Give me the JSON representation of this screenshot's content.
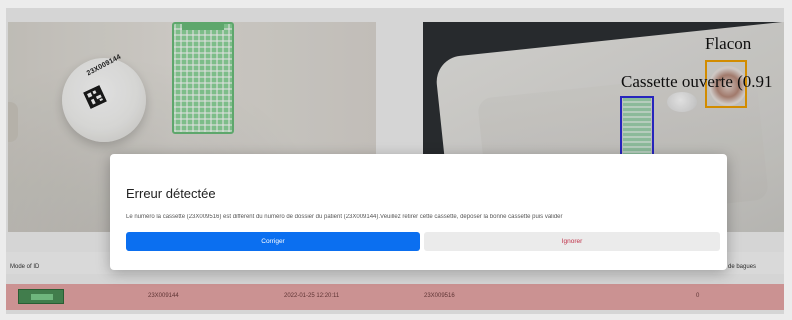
{
  "left_camera": {
    "vial_label": "23X009144"
  },
  "right_camera": {
    "detection_flacon": "Flacon",
    "detection_cassette": "Cassette ouverte (0.91"
  },
  "table": {
    "headers": [
      "Mode of ID",
      "de bagues"
    ],
    "row": {
      "patient_number": "23X009144",
      "date": "2022-01-25 12:20:11",
      "cassette_number": "23X009516",
      "count": "0"
    }
  },
  "modal": {
    "title": "Erreur détectée",
    "message": "Le numéro la cassette (23X009516) est différent du numéro de dossier du patient (23X009144).Veuillez retirer cette cassette, déposer la bonne cassette puis valider",
    "confirm_label": "Corriger",
    "ignore_label": "Ignorer"
  },
  "colors": {
    "primary": "#0b6ff0",
    "danger_text": "#c0334a",
    "row_error": "#e8a7a7",
    "bbox_cassette": "#2d2bd8",
    "bbox_flacon": "#f0a000"
  }
}
